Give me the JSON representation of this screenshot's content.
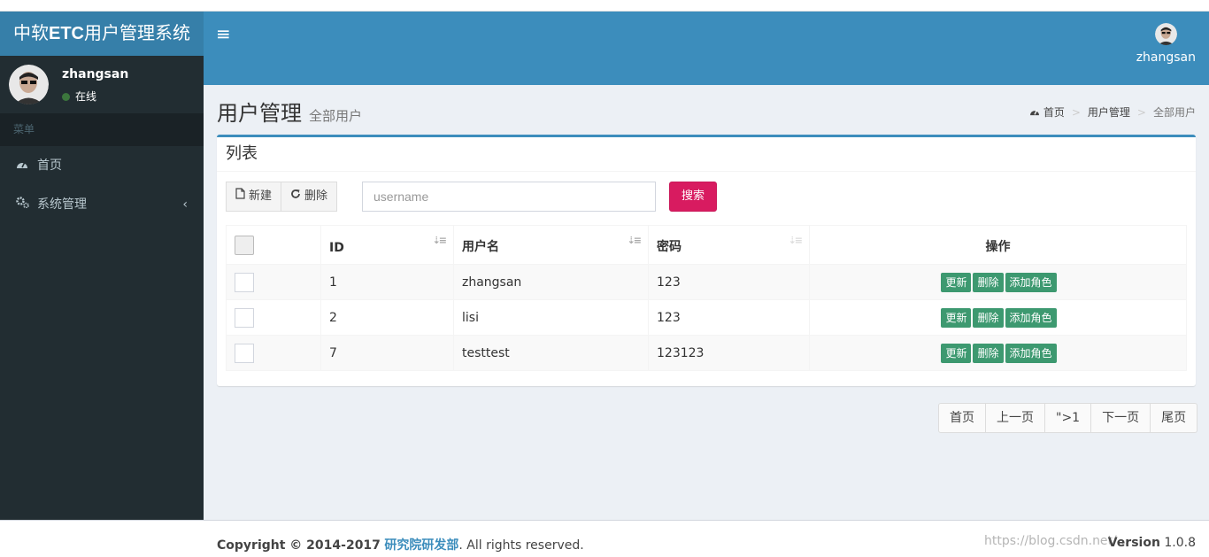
{
  "app": {
    "logo_prefix": "中软",
    "logo_bold": "ETC",
    "logo_suffix": "用户管理系统",
    "menu_toggle_icon": "hamburger-icon"
  },
  "header_user": {
    "name": "zhangsan"
  },
  "sidebar": {
    "user_name": "zhangsan",
    "status": "在线",
    "status_color": "#3c763d",
    "menu_header": "菜单",
    "items": [
      {
        "label": "首页",
        "icon": "dashboard-icon"
      },
      {
        "label": "系统管理",
        "icon": "cogs-icon",
        "chevron": "‹"
      }
    ]
  },
  "content": {
    "title": "用户管理",
    "subtitle": "全部用户",
    "breadcrumb": [
      {
        "label": "首页",
        "icon": "dashboard-icon"
      },
      {
        "label": "用户管理"
      },
      {
        "label": "全部用户"
      }
    ]
  },
  "box": {
    "title": "列表",
    "new_label": "新建",
    "delete_label": "删除",
    "search_placeholder": "username",
    "search_label": "搜索"
  },
  "table": {
    "columns": [
      "ID",
      "用户名",
      "密码",
      "操作"
    ],
    "rows": [
      {
        "id": "1",
        "username": "zhangsan",
        "password": "123"
      },
      {
        "id": "2",
        "username": "lisi",
        "password": "123"
      },
      {
        "id": "7",
        "username": "testtest",
        "password": "123123"
      }
    ],
    "actions": [
      "更新",
      "删除",
      "添加角色"
    ],
    "action_color": "#3d9970"
  },
  "pagination": [
    "首页",
    "上一页",
    "\">1",
    "下一页",
    "尾页"
  ],
  "footer": {
    "copyright_prefix": "Copyright © 2014-2017",
    "org": "研究院研发部",
    "suffix": ". All rights reserved.",
    "watermark": "https://blog.csdn.net/...",
    "version_label": "Version",
    "version": "1.0.8"
  },
  "colors": {
    "header": "#3c8dbc",
    "logo_bg": "#367fa9",
    "sidebar": "#222d32",
    "search_button": "#d81b60"
  }
}
